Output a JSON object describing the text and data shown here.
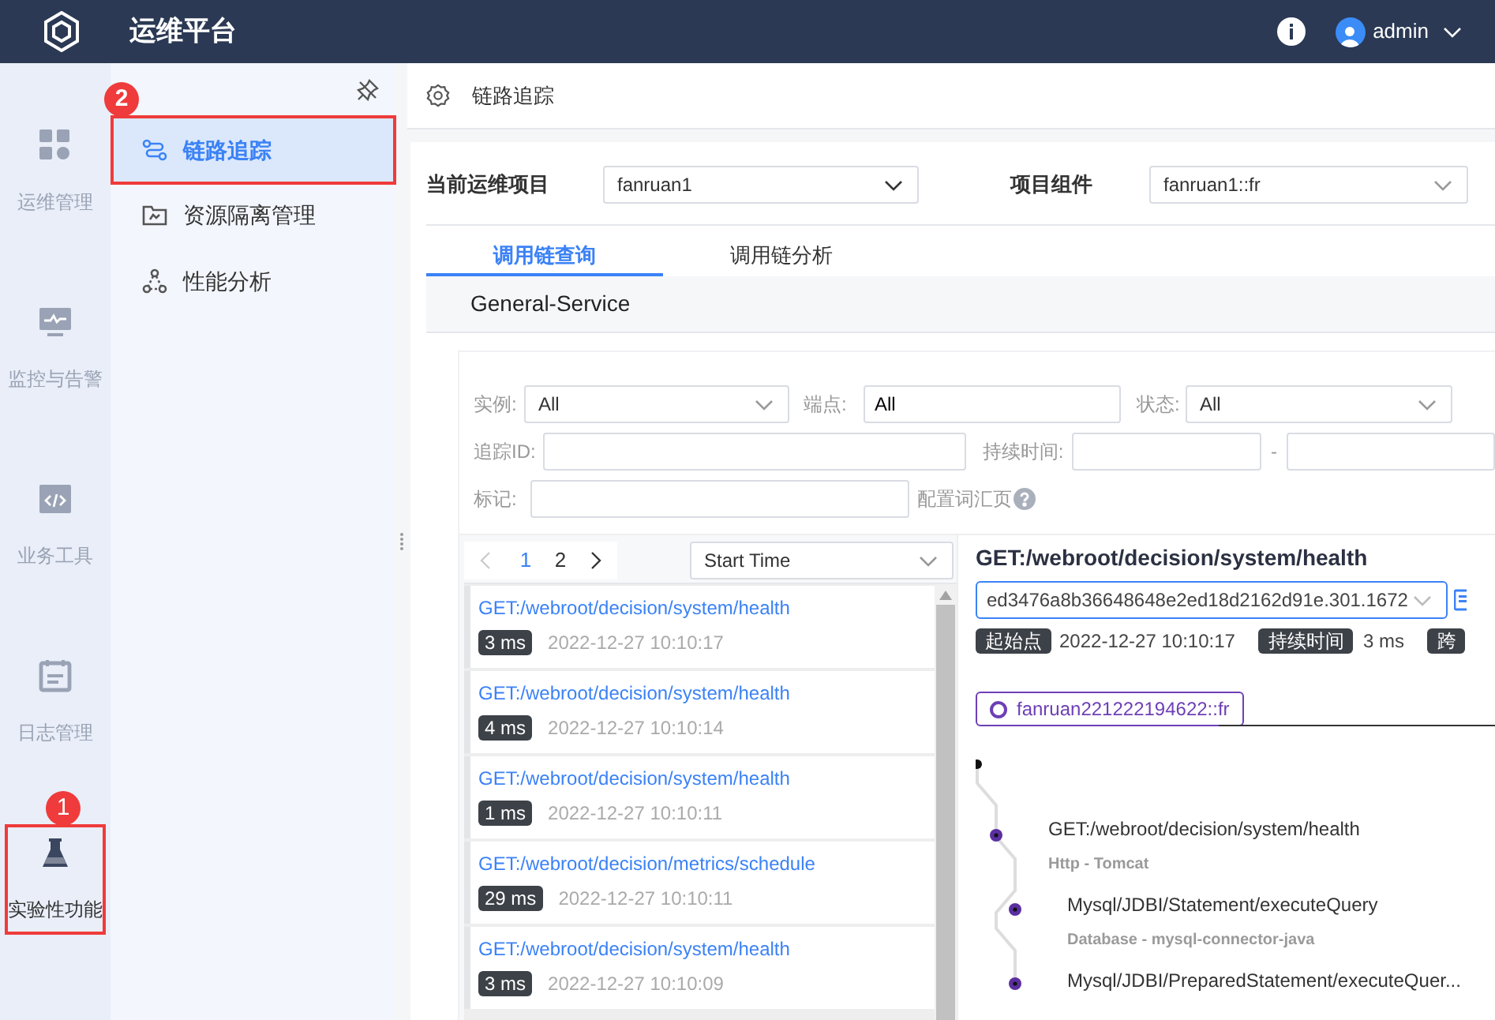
{
  "header": {
    "title": "运维平台",
    "user": "admin"
  },
  "rail": [
    {
      "label": "运维管理",
      "selected": false
    },
    {
      "label": "监控与告警",
      "selected": false
    },
    {
      "label": "业务工具",
      "selected": false
    },
    {
      "label": "日志管理",
      "selected": false
    },
    {
      "label": "实验性功能",
      "selected": true,
      "callout": "1"
    }
  ],
  "submenu": [
    {
      "label": "链路追踪",
      "selected": true,
      "callout": "2"
    },
    {
      "label": "资源隔离管理",
      "selected": false
    },
    {
      "label": "性能分析",
      "selected": false
    }
  ],
  "page_title": "链路追踪",
  "project": {
    "label": "当前运维项目",
    "value": "fanruan1"
  },
  "component": {
    "label": "项目组件",
    "value": "fanruan1::fr"
  },
  "tabs": [
    {
      "label": "调用链查询",
      "selected": true
    },
    {
      "label": "调用链分析",
      "selected": false
    }
  ],
  "service": "General-Service",
  "filters": {
    "instance": {
      "label": "实例:",
      "value": "All"
    },
    "endpoint": {
      "label": "端点:",
      "value": "All"
    },
    "status": {
      "label": "状态:",
      "value": "All"
    },
    "trace_id": {
      "label": "追踪ID:"
    },
    "duration": {
      "label": "持续时间:",
      "separator": "-"
    },
    "tag": {
      "label": "标记:"
    },
    "glossary": "配置词汇页"
  },
  "pagination": {
    "pages": [
      {
        "label": "1",
        "selected": true
      },
      {
        "label": "2",
        "selected": false
      }
    ]
  },
  "sort": "Start Time",
  "traces": [
    {
      "endpoint": "GET:/webroot/decision/system/health",
      "duration": "3 ms",
      "time": "2022-12-27 10:10:17"
    },
    {
      "endpoint": "GET:/webroot/decision/system/health",
      "duration": "4 ms",
      "time": "2022-12-27 10:10:14"
    },
    {
      "endpoint": "GET:/webroot/decision/system/health",
      "duration": "1 ms",
      "time": "2022-12-27 10:10:11"
    },
    {
      "endpoint": "GET:/webroot/decision/metrics/schedule",
      "duration": "29 ms",
      "time": "2022-12-27 10:10:11"
    },
    {
      "endpoint": "GET:/webroot/decision/system/health",
      "duration": "3 ms",
      "time": "2022-12-27 10:10:09"
    }
  ],
  "detail": {
    "title": "GET:/webroot/decision/system/health",
    "trace_id": "ed3476a8b36648648e2ed18d2162d91e.301.1672",
    "start_label": "起始点",
    "start": "2022-12-27 10:10:17",
    "duration_label": "持续时间",
    "duration": "3 ms",
    "span_label": "跨",
    "node": "fanruan221222194622::fr",
    "spans": [
      {
        "name": "GET:/webroot/decision/system/health",
        "type": "Http - Tomcat",
        "children": [
          {
            "name": "Mysql/JDBI/Statement/executeQuery",
            "type": "Database - mysql-connector-java"
          },
          {
            "name": "Mysql/JDBI/PreparedStatement/executeQuer..."
          }
        ]
      }
    ]
  }
}
